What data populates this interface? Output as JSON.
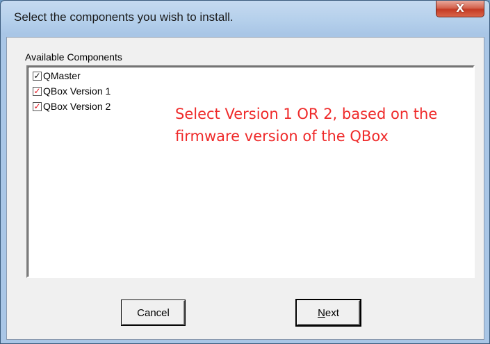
{
  "window": {
    "title": "Select the components you wish to install.",
    "close_glyph": "X"
  },
  "components": {
    "label": "Available Components",
    "items": [
      {
        "label": "QMaster",
        "checked": true,
        "check_color": "#000000"
      },
      {
        "label": "QBox Version 1",
        "checked": true,
        "check_color": "#e0101a"
      },
      {
        "label": "QBox Version 2",
        "checked": true,
        "check_color": "#e0101a"
      }
    ],
    "check_glyph": "✓"
  },
  "annotation": {
    "text": "Select Version 1 OR 2, based on the firmware version of the QBox",
    "color": "#ef2a2a"
  },
  "buttons": {
    "cancel_label": "Cancel",
    "next_mnemonic": "N",
    "next_rest": "ext"
  }
}
